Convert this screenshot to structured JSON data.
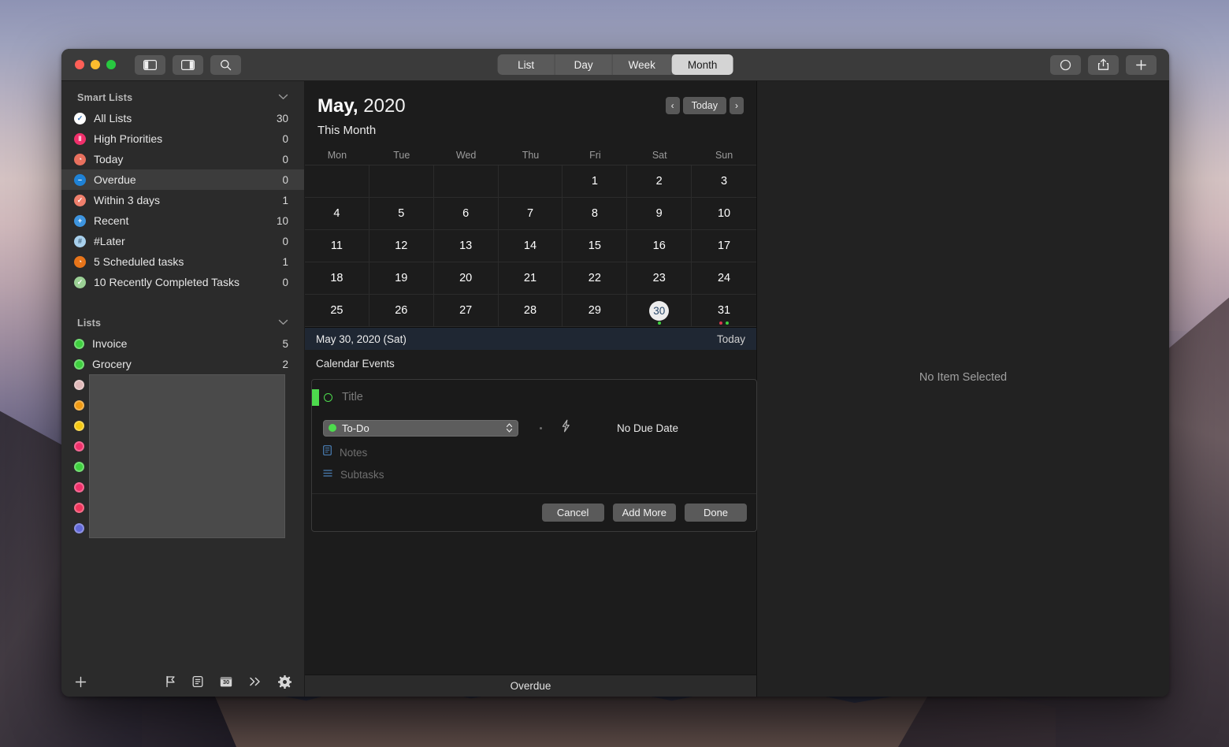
{
  "titlebar": {
    "traffic_lights": [
      "close",
      "minimize",
      "zoom"
    ],
    "left_buttons": [
      {
        "name": "toggle-left-sidebar",
        "icon": "sidebar-left-icon"
      },
      {
        "name": "toggle-right-sidebar",
        "icon": "sidebar-right-icon"
      },
      {
        "name": "search",
        "icon": "search-icon"
      }
    ],
    "segments": [
      {
        "label": "List",
        "active": false
      },
      {
        "label": "Day",
        "active": false
      },
      {
        "label": "Week",
        "active": false
      },
      {
        "label": "Month",
        "active": true
      }
    ],
    "right_buttons": [
      {
        "name": "focus-circle",
        "icon": "circle-icon"
      },
      {
        "name": "share",
        "icon": "share-icon"
      },
      {
        "name": "add",
        "icon": "plus-icon"
      }
    ]
  },
  "sidebar": {
    "smart_lists_header": "Smart Lists",
    "lists_header": "Lists",
    "smart_lists": [
      {
        "label": "All Lists",
        "count": "30",
        "icon": "check-circle-icon",
        "color": "#ffffff",
        "glyph": "✓",
        "glyph_color": "#2f6fb5",
        "selected": false
      },
      {
        "label": "High Priorities",
        "count": "0",
        "icon": "priority-icon",
        "color": "#f0306b",
        "glyph": "‖",
        "glyph_color": "#ffffff",
        "selected": false
      },
      {
        "label": "Today",
        "count": "0",
        "icon": "clock-icon",
        "color": "#e8705e",
        "glyph": "◔",
        "glyph_color": "#ffffff",
        "selected": false
      },
      {
        "label": "Overdue",
        "count": "0",
        "icon": "minus-circle-icon",
        "color": "#1f82d6",
        "glyph": "–",
        "glyph_color": "#ffffff",
        "selected": true
      },
      {
        "label": "Within 3 days",
        "count": "1",
        "icon": "check-circle-icon",
        "color": "#ef7f6c",
        "glyph": "✓",
        "glyph_color": "#ffffff",
        "selected": false
      },
      {
        "label": "Recent",
        "count": "10",
        "icon": "plus-circle-icon",
        "color": "#3e95e0",
        "glyph": "+",
        "glyph_color": "#ffffff",
        "selected": false
      },
      {
        "label": "#Later",
        "count": "0",
        "icon": "hashtag-icon",
        "color": "#a8d0ec",
        "glyph": "#",
        "glyph_color": "#41617c",
        "selected": false
      },
      {
        "label": "5 Scheduled tasks",
        "count": "1",
        "icon": "clock-icon",
        "color": "#e8751a",
        "glyph": "◔",
        "glyph_color": "#ffffff",
        "selected": false
      },
      {
        "label": "10 Recently Completed Tasks",
        "count": "0",
        "icon": "check-circle-icon",
        "color": "#9bd095",
        "glyph": "✓",
        "glyph_color": "#ffffff",
        "selected": false
      }
    ],
    "lists": [
      {
        "label": "Invoice",
        "count": "5",
        "color": "#3fd03f"
      },
      {
        "label": "Grocery",
        "count": "2",
        "color": "#3fd03f"
      }
    ],
    "hidden_list_colors": [
      "#e0b9b9",
      "#f09a12",
      "#f5c811",
      "#f0306b",
      "#3fd03f",
      "#f0306b",
      "#f0355c",
      "#6269d8"
    ],
    "bottom_icons": [
      {
        "name": "add-list",
        "icon": "plus-icon"
      },
      {
        "name": "flag-filter",
        "icon": "flag-icon"
      },
      {
        "name": "note-view",
        "icon": "note-icon"
      },
      {
        "name": "calendar-view",
        "icon": "calendar-30-icon",
        "label": "30"
      },
      {
        "name": "expand-more",
        "icon": "chevron-double-right-icon"
      },
      {
        "name": "settings",
        "icon": "gear-icon"
      }
    ]
  },
  "calendar": {
    "title_month": "May,",
    "title_year": "2020",
    "subtitle": "This Month",
    "nav": {
      "prev": "‹",
      "today": "Today",
      "next": "›"
    },
    "day_names": [
      "Mon",
      "Tue",
      "Wed",
      "Thu",
      "Fri",
      "Sat",
      "Sun"
    ],
    "weeks": [
      [
        {
          "day": ""
        },
        {
          "day": ""
        },
        {
          "day": ""
        },
        {
          "day": ""
        },
        {
          "day": "1"
        },
        {
          "day": "2"
        },
        {
          "day": "3"
        }
      ],
      [
        {
          "day": "4"
        },
        {
          "day": "5"
        },
        {
          "day": "6"
        },
        {
          "day": "7"
        },
        {
          "day": "8"
        },
        {
          "day": "9"
        },
        {
          "day": "10"
        }
      ],
      [
        {
          "day": "11"
        },
        {
          "day": "12"
        },
        {
          "day": "13"
        },
        {
          "day": "14"
        },
        {
          "day": "15"
        },
        {
          "day": "16"
        },
        {
          "day": "17"
        }
      ],
      [
        {
          "day": "18"
        },
        {
          "day": "19"
        },
        {
          "day": "20"
        },
        {
          "day": "21"
        },
        {
          "day": "22"
        },
        {
          "day": "23"
        },
        {
          "day": "24"
        }
      ],
      [
        {
          "day": "25"
        },
        {
          "day": "26"
        },
        {
          "day": "27"
        },
        {
          "day": "28"
        },
        {
          "day": "29"
        },
        {
          "day": "30",
          "selected": true,
          "dots": [
            "#3fd03f"
          ]
        },
        {
          "day": "31",
          "dots": [
            "#d8384f",
            "#3fd03f"
          ]
        }
      ]
    ],
    "day_bar": {
      "date": "May 30, 2020 (Sat)",
      "today": "Today"
    },
    "events_label": "Calendar Events"
  },
  "editor": {
    "accent_color": "#4ddb4d",
    "title_placeholder": "Title",
    "type_label": "To-Do",
    "type_dot_color": "#4ddb4d",
    "due_label": "No Due Date",
    "notes_label": "Notes",
    "subtasks_label": "Subtasks",
    "buttons": [
      {
        "label": "Cancel",
        "name": "cancel-button"
      },
      {
        "label": "Add More",
        "name": "add-more-button"
      },
      {
        "label": "Done",
        "name": "done-button"
      }
    ]
  },
  "statusbar": {
    "label": "Overdue"
  },
  "detail": {
    "empty_label": "No Item Selected"
  }
}
